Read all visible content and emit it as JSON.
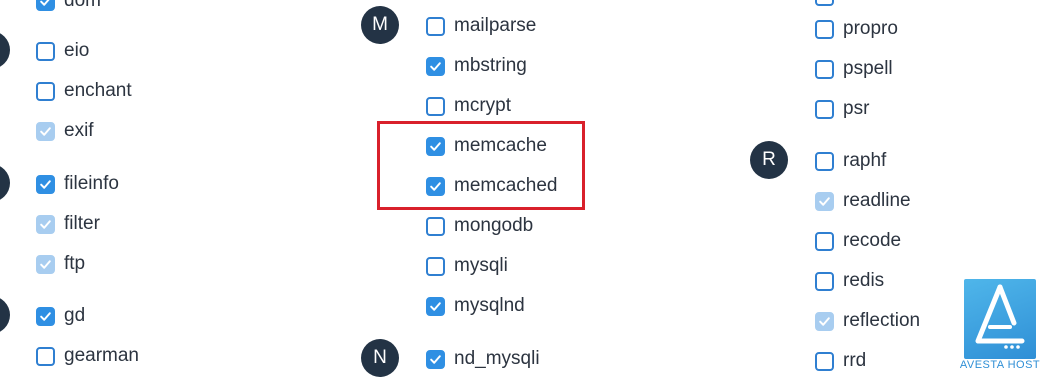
{
  "columns": [
    {
      "id": "col1",
      "items": [
        {
          "label": "dom",
          "state": "checked"
        },
        {
          "label": "eio",
          "state": "unchecked"
        },
        {
          "label": "enchant",
          "state": "unchecked"
        },
        {
          "label": "exif",
          "state": "disabled"
        },
        {
          "label": "fileinfo",
          "state": "checked"
        },
        {
          "label": "filter",
          "state": "disabled"
        },
        {
          "label": "ftp",
          "state": "disabled"
        },
        {
          "label": "gd",
          "state": "checked"
        },
        {
          "label": "gearman",
          "state": "unchecked"
        }
      ]
    },
    {
      "id": "col2",
      "letters": [
        "M",
        "N"
      ],
      "items": [
        {
          "label": "mailparse",
          "state": "unchecked"
        },
        {
          "label": "mbstring",
          "state": "checked"
        },
        {
          "label": "mcrypt",
          "state": "unchecked"
        },
        {
          "label": "memcache",
          "state": "checked"
        },
        {
          "label": "memcached",
          "state": "checked"
        },
        {
          "label": "mongodb",
          "state": "unchecked"
        },
        {
          "label": "mysqli",
          "state": "unchecked"
        },
        {
          "label": "mysqlnd",
          "state": "checked"
        },
        {
          "label": "nd_mysqli",
          "state": "checked"
        }
      ]
    },
    {
      "id": "col3",
      "letters": [
        "R"
      ],
      "items": [
        {
          "label": "propro",
          "state": "unchecked"
        },
        {
          "label": "pspell",
          "state": "unchecked"
        },
        {
          "label": "psr",
          "state": "unchecked"
        },
        {
          "label": "raphf",
          "state": "unchecked"
        },
        {
          "label": "readline",
          "state": "disabled"
        },
        {
          "label": "recode",
          "state": "unchecked"
        },
        {
          "label": "redis",
          "state": "unchecked"
        },
        {
          "label": "reflection",
          "state": "disabled"
        },
        {
          "label": "rrd",
          "state": "unchecked"
        }
      ]
    }
  ],
  "watermark": {
    "text": "AVESTA HOST",
    "icon": "avesta-host-logo-icon"
  },
  "colors": {
    "checkbox_checked": "#2f8fe3",
    "checkbox_disabled": "#a8cdf0",
    "checkbox_border": "#2f7fd1",
    "letter_badge": "#233345",
    "highlight": "#d9202b"
  }
}
